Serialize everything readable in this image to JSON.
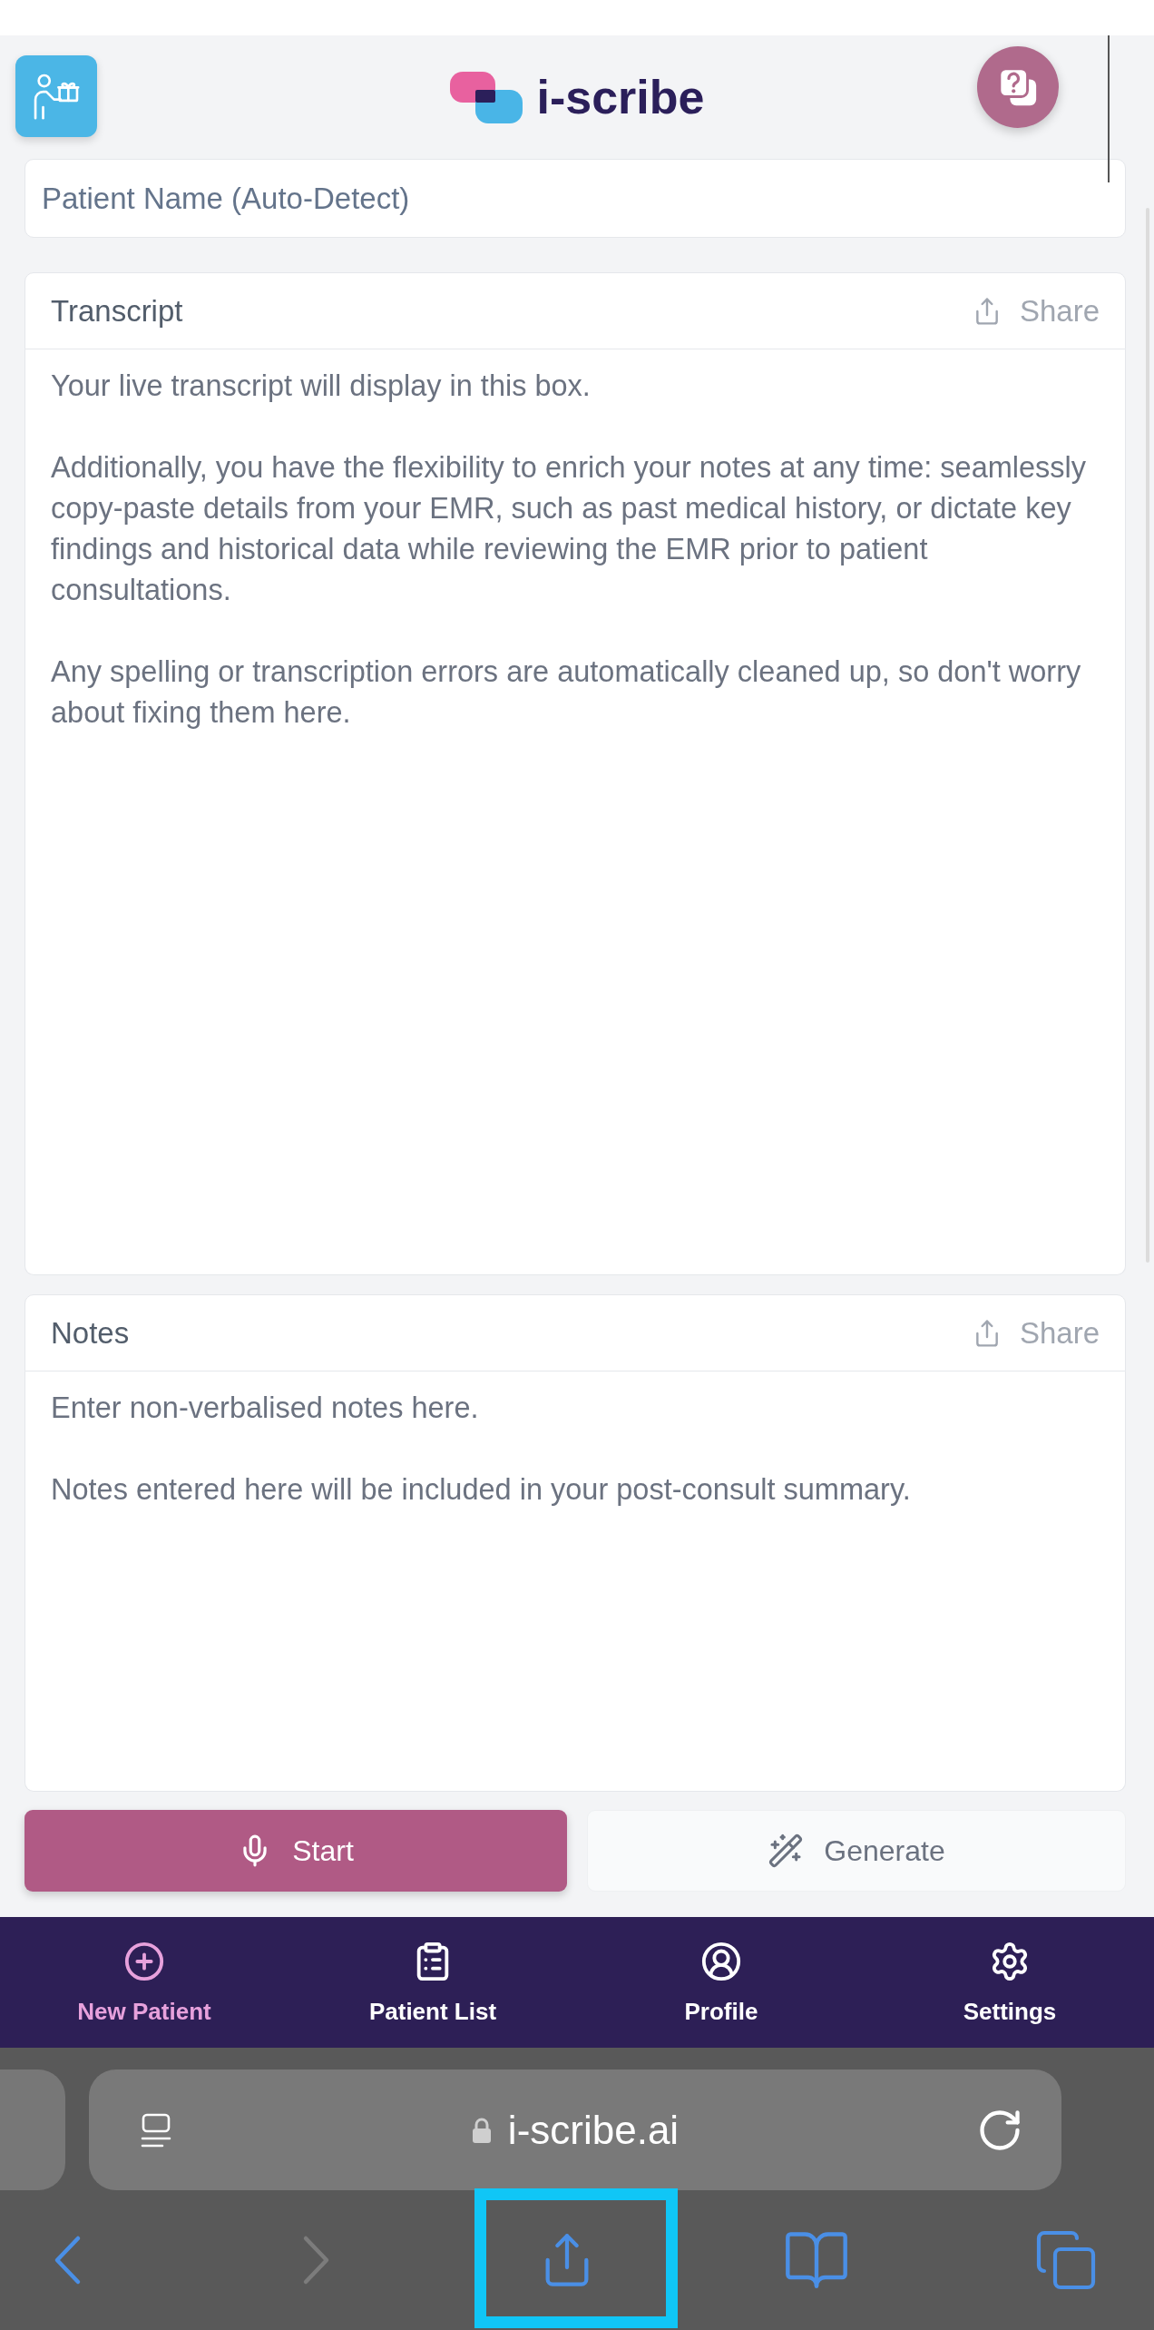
{
  "header": {
    "logo_text": "i-scribe"
  },
  "patient_name": {
    "placeholder": "Patient Name (Auto-Detect)"
  },
  "panels": [
    {
      "title": "Transcript",
      "share_label": "Share",
      "placeholder": "Your live transcript will display in this box.\n\nAdditionally, you have the flexibility to enrich your notes at any time: seamlessly copy-paste details from your EMR, such as past medical history, or dictate key findings and historical data while reviewing the EMR prior to patient consultations.\n\nAny spelling or transcription errors are automatically cleaned up, so don't worry about fixing them here."
    },
    {
      "title": "Notes",
      "share_label": "Share",
      "placeholder": "Enter non-verbalised notes here.\n\nNotes entered here will be included in your post-consult summary."
    }
  ],
  "actions": [
    {
      "kind": "record",
      "label": "Start"
    },
    {
      "kind": "generate",
      "label": "Generate"
    }
  ],
  "bottom_nav": [
    {
      "label": "New Patient",
      "selected": true
    },
    {
      "label": "Patient List",
      "selected": false
    },
    {
      "label": "Profile",
      "selected": false
    },
    {
      "label": "Settings",
      "selected": false
    }
  ],
  "browser": {
    "url": "i-scribe.ai",
    "toolbar": [
      {
        "kind": "back",
        "disabled": false,
        "highlighted": false
      },
      {
        "kind": "forward",
        "disabled": true,
        "highlighted": false
      },
      {
        "kind": "share",
        "disabled": false,
        "highlighted": true
      },
      {
        "kind": "bookmarks",
        "disabled": false,
        "highlighted": false
      },
      {
        "kind": "tabs",
        "disabled": false,
        "highlighted": false
      }
    ]
  }
}
